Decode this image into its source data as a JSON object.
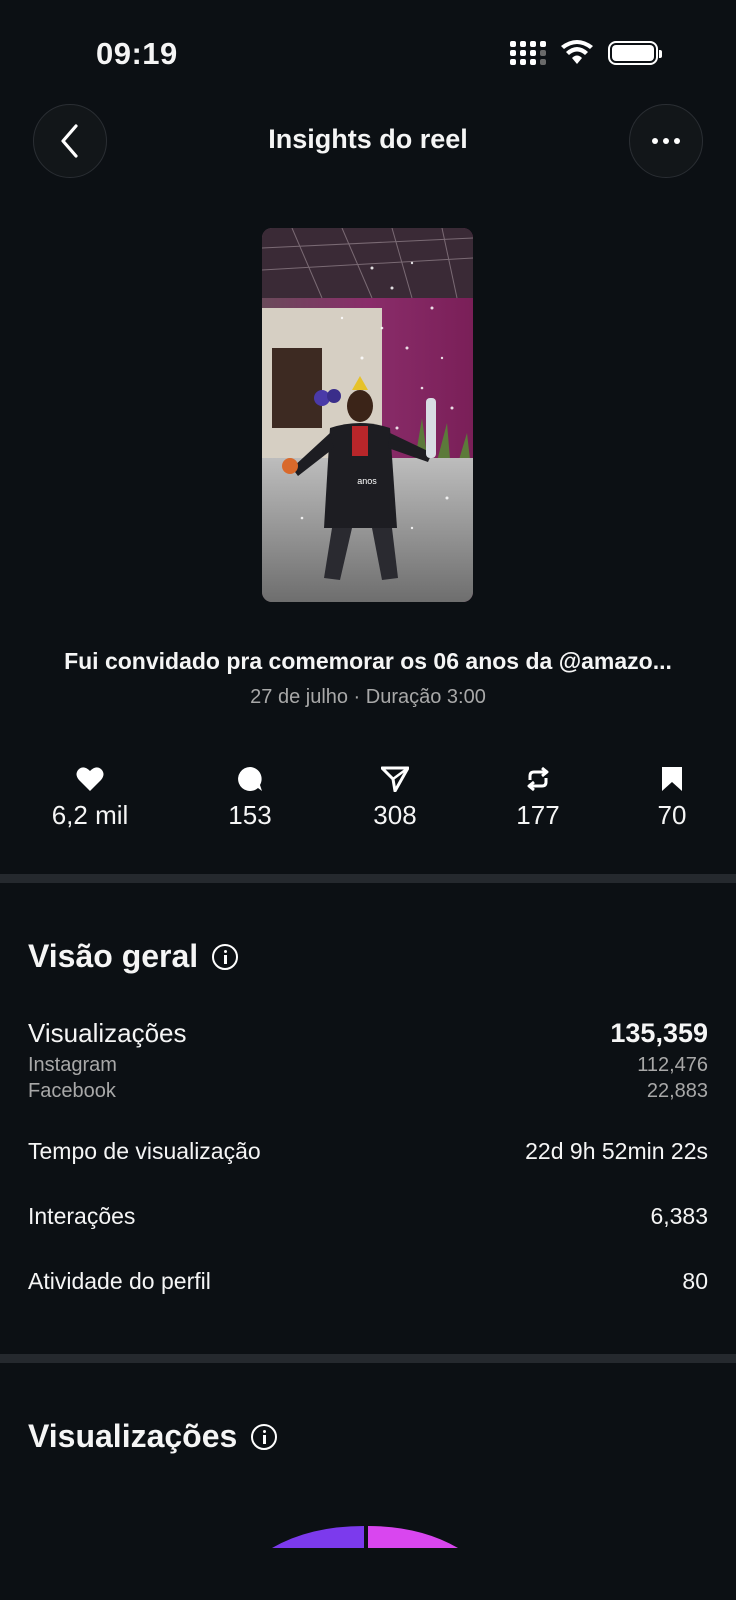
{
  "status_bar": {
    "time": "09:19"
  },
  "header": {
    "title": "Insights do reel",
    "back_icon": "chevron-left-icon",
    "more_icon": "ellipsis-icon"
  },
  "reel": {
    "thumbnail_text": "anos",
    "caption": "Fui convidado pra comemorar os 06 anos da @amazo...",
    "meta": "27 de julho · Duração 3:00"
  },
  "stats": [
    {
      "icon": "heart-icon",
      "value": "6,2 mil"
    },
    {
      "icon": "comment-icon",
      "value": "153"
    },
    {
      "icon": "send-icon",
      "value": "308"
    },
    {
      "icon": "repost-icon",
      "value": "177"
    },
    {
      "icon": "bookmark-icon",
      "value": "70"
    }
  ],
  "overview": {
    "title": "Visão geral",
    "views_label": "Visualizações",
    "views_value": "135,359",
    "instagram_label": "Instagram",
    "instagram_value": "112,476",
    "facebook_label": "Facebook",
    "facebook_value": "22,883",
    "watch_time_label": "Tempo de visualização",
    "watch_time_value": "22d 9h 52min 22s",
    "interactions_label": "Interações",
    "interactions_value": "6,383",
    "profile_activity_label": "Atividade do perfil",
    "profile_activity_value": "80"
  },
  "views_section": {
    "title": "Visualizações"
  },
  "colors": {
    "background": "#0c1014",
    "divider": "#25292e",
    "donut_left": "#7c3aed",
    "donut_right": "#d946ef"
  }
}
